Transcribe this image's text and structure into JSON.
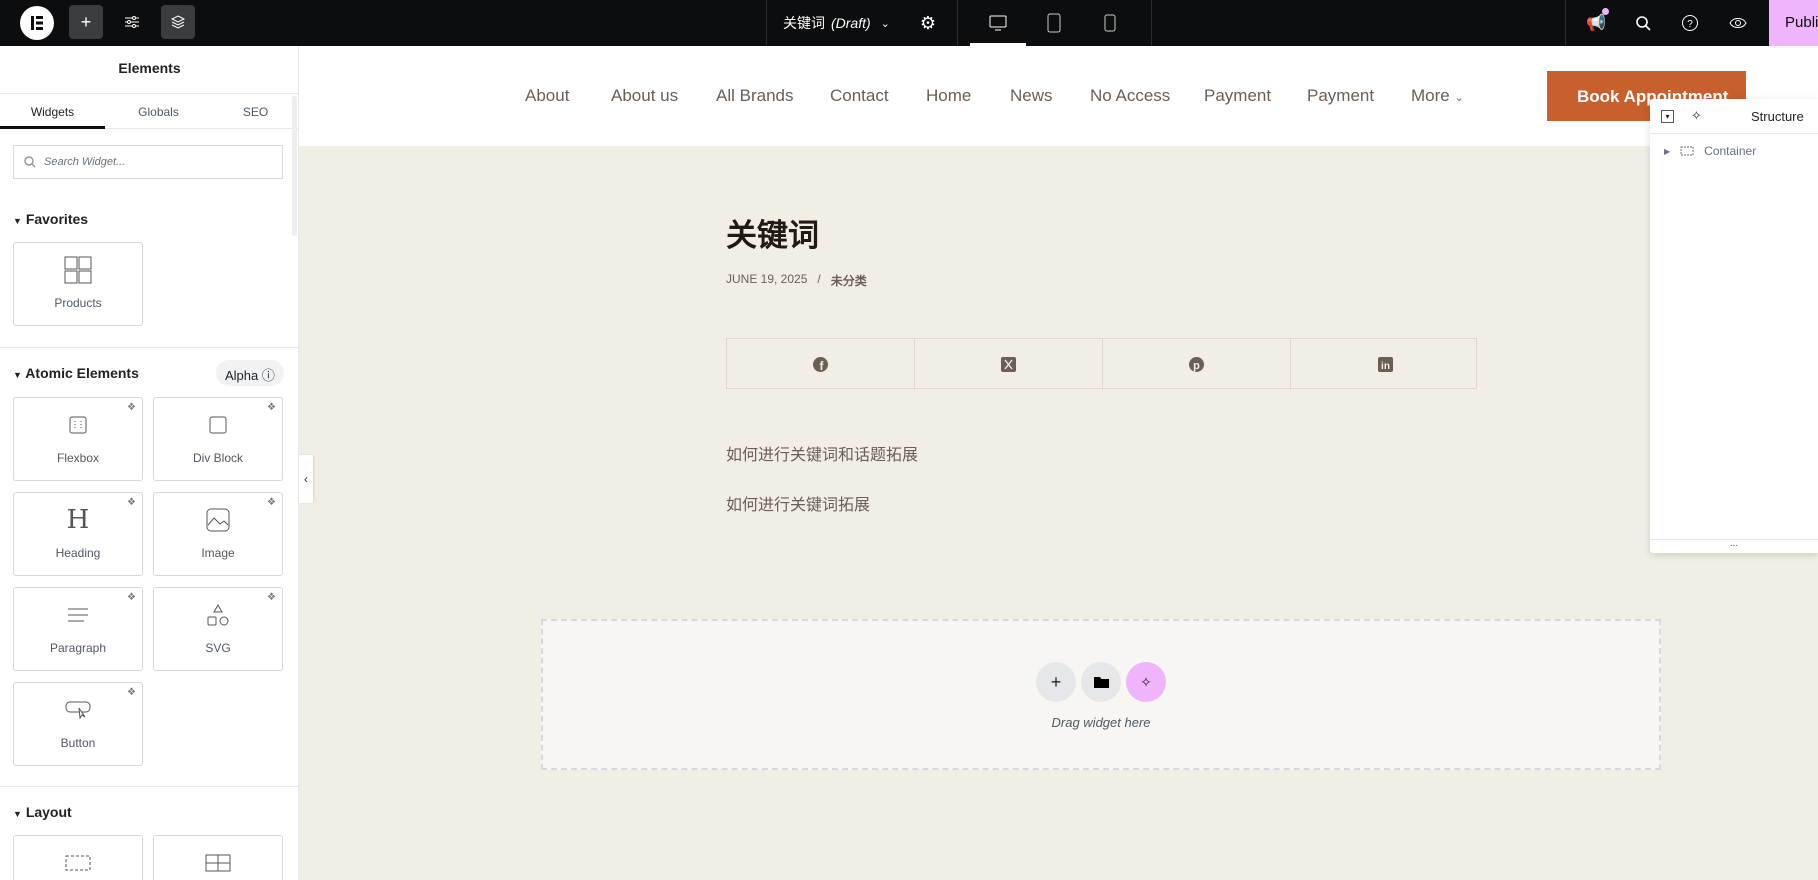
{
  "topbar": {
    "doc_title": "关键词",
    "doc_status": "(Draft)",
    "publish_label": "Publish"
  },
  "sidebar": {
    "title": "Elements",
    "tabs": [
      {
        "label": "Widgets"
      },
      {
        "label": "Globals"
      },
      {
        "label": "SEO"
      }
    ],
    "search_placeholder": "Search Widget...",
    "favorites": {
      "title": "Favorites",
      "items": [
        {
          "label": "Products"
        }
      ]
    },
    "atomic": {
      "title": "Atomic Elements",
      "badge": "Alpha",
      "items": [
        {
          "label": "Flexbox"
        },
        {
          "label": "Div Block"
        },
        {
          "label": "Heading"
        },
        {
          "label": "Image"
        },
        {
          "label": "Paragraph"
        },
        {
          "label": "SVG"
        },
        {
          "label": "Button"
        }
      ]
    },
    "layout": {
      "title": "Layout"
    }
  },
  "site": {
    "nav": [
      {
        "label": "About"
      },
      {
        "label": "About us"
      },
      {
        "label": "All Brands"
      },
      {
        "label": "Contact"
      },
      {
        "label": "Home"
      },
      {
        "label": "News"
      },
      {
        "label": "No Access"
      },
      {
        "label": "Payment"
      },
      {
        "label": "Payment"
      },
      {
        "label": "More"
      }
    ],
    "cta": "Book Appointment",
    "post": {
      "title": "关键词",
      "date": "JUNE 19, 2025",
      "meta_sep": "/",
      "category": "未分类",
      "share": [
        "facebook",
        "x",
        "pinterest",
        "linkedin"
      ],
      "paragraphs": [
        "如何进行关键词和话题拓展",
        "如何进行关键词拓展"
      ]
    },
    "dropzone": "Drag widget here"
  },
  "structure": {
    "title": "Structure",
    "items": [
      {
        "label": "Container"
      }
    ],
    "footer": "..."
  },
  "colors": {
    "accent": "#c85f2c",
    "publish": "#f0b4fc",
    "canvas": "#f1eee6"
  }
}
